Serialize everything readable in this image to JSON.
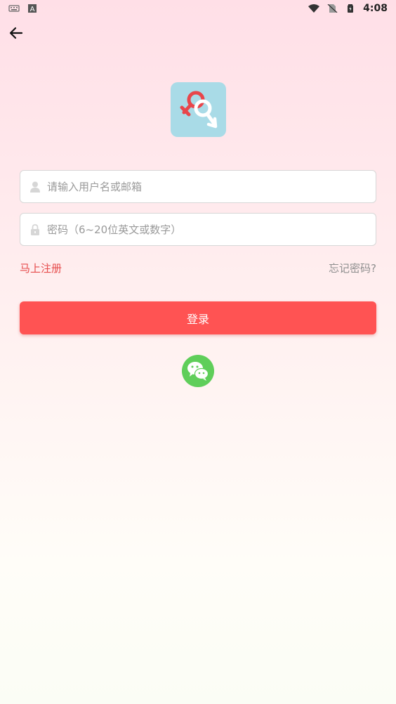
{
  "status_bar": {
    "time": "4:08",
    "icons": [
      "keyboard-icon",
      "a-badge-icon",
      "wifi-icon",
      "no-sim-icon",
      "battery-icon"
    ]
  },
  "nav": {
    "back_icon": "arrow-left-icon"
  },
  "logo": {
    "icon": "gender-symbols-icon",
    "bg_color": "#a9dbe7"
  },
  "form": {
    "username_placeholder": "请输入用户名或邮箱",
    "username_value": "",
    "password_placeholder": "密码（6~20位英文或数字）",
    "password_value": ""
  },
  "links": {
    "register": "马上注册",
    "forgot": "忘记密码?"
  },
  "login_button": {
    "label": "登录",
    "color": "#ff5353"
  },
  "social": {
    "wechat_icon": "wechat-icon",
    "color": "#5fce5a"
  },
  "colors": {
    "accent": "#ff5353",
    "register_text": "#e64b4b"
  }
}
